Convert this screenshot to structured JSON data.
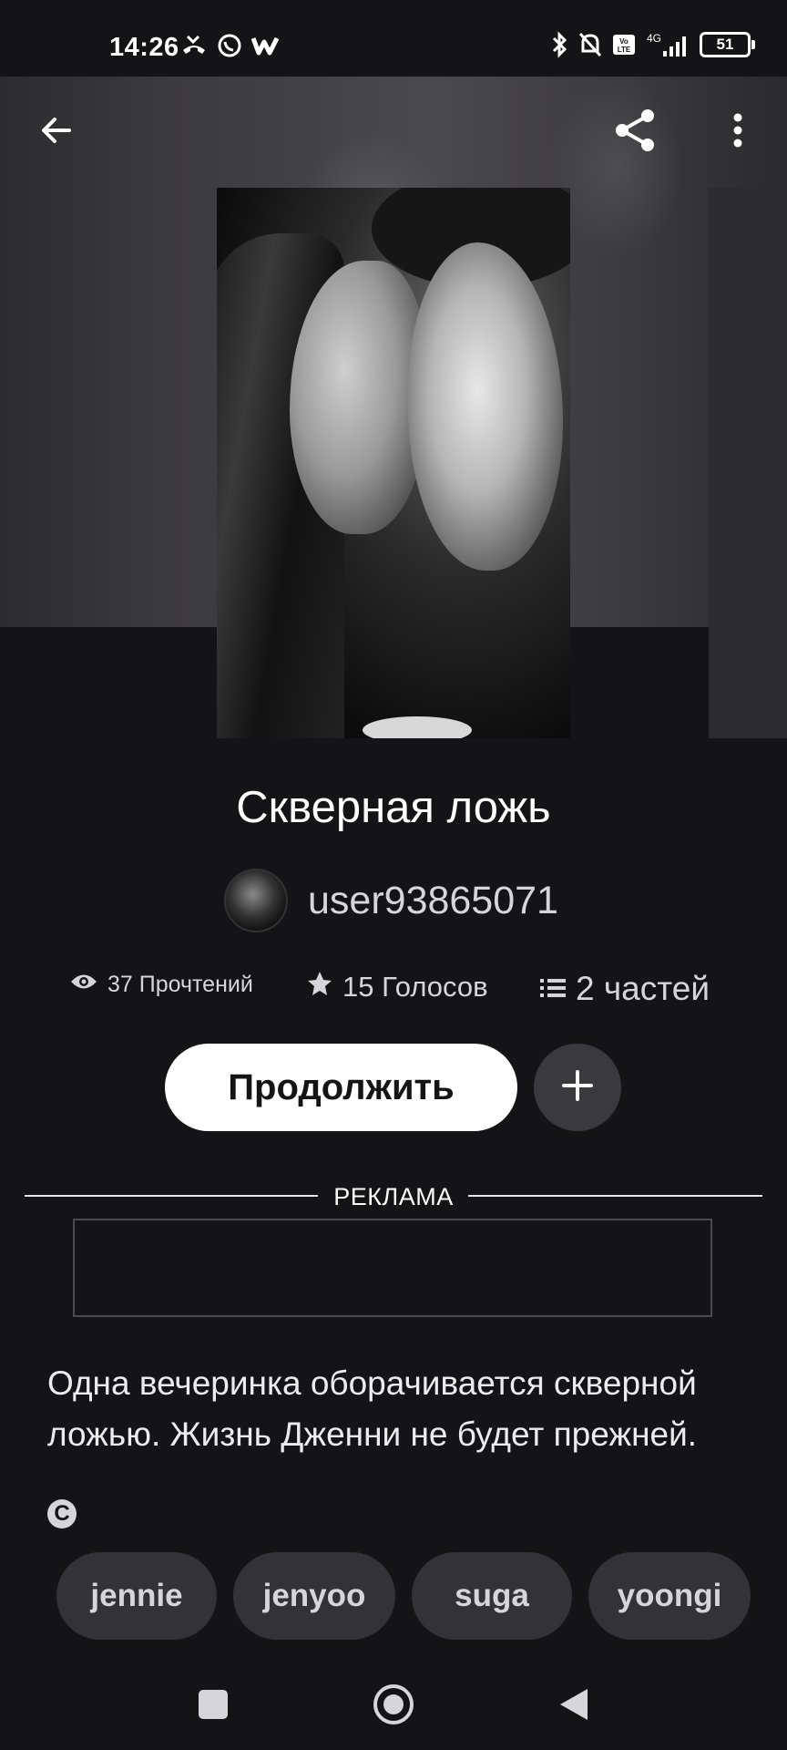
{
  "status_bar": {
    "time": "14:26",
    "left_icons": [
      "missed-call-icon",
      "whatsapp-icon",
      "wattpad-icon"
    ],
    "right_icons": [
      "bluetooth-icon",
      "mute-bell-icon",
      "volte-icon",
      "4g-signal-icon"
    ],
    "network_label": "4G",
    "volte_label": "Vo LTE",
    "battery": "51"
  },
  "app_bar": {
    "back_icon": "arrow-left-icon",
    "share_icon": "share-icon",
    "more_icon": "more-vert-icon"
  },
  "story": {
    "title": "Скверная ложь",
    "author": "user93865071",
    "stats": {
      "reads": "37 Прочтений",
      "votes": "15 Голосов",
      "parts": "2 частей"
    },
    "continue_label": "Продолжить",
    "description": "Одна вечеринка оборачивается скверной ложью. Жизнь Дженни не будет прежней.",
    "copyright_symbol": "C",
    "tags": [
      "jennie",
      "jenyoo",
      "suga",
      "yoongi"
    ]
  },
  "ad": {
    "label": "РЕКЛАМА"
  },
  "nav_bar": {
    "buttons": [
      "recents-square-icon",
      "home-circle-icon",
      "back-triangle-icon"
    ]
  }
}
